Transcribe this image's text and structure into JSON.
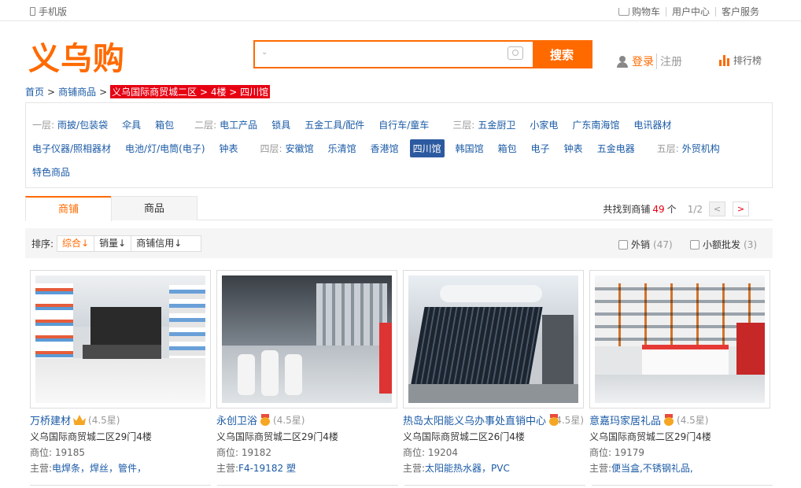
{
  "topbar": {
    "mobile": "手机版",
    "cart": "购物车",
    "user_center": "用户中心",
    "service": "客户服务"
  },
  "header": {
    "logo": "义乌购",
    "search": {
      "value": "",
      "placeholder": "",
      "button": "搜索"
    },
    "login": "登录",
    "register": "注册",
    "ranking": "排行榜"
  },
  "breadcrumb": {
    "home": "首页",
    "shops": "商铺商品",
    "current": "义乌国际商贸城二区 > 4楼 > 四川馆",
    "sep": ">"
  },
  "floors": {
    "row1": [
      {
        "label": "一层:",
        "items": [
          "雨披/包装袋",
          "伞具",
          "箱包"
        ]
      },
      {
        "label": "二层:",
        "items": [
          "电工产品",
          "锁具",
          "五金工具/配件",
          "自行车/童车"
        ]
      },
      {
        "label": "三层:",
        "items": [
          "五金厨卫",
          "小家电",
          "广东南海馆",
          "电讯器材"
        ]
      }
    ],
    "row2_plain": [
      "电子仪器/照相器材",
      "电池/灯/电筒(电子)",
      "钟表"
    ],
    "row2_floor4": {
      "label": "四层:",
      "items": [
        "安徽馆",
        "乐清馆",
        "香港馆",
        "四川馆",
        "韩国馆",
        "箱包",
        "电子",
        "钟表",
        "五金电器"
      ],
      "active": "四川馆"
    },
    "row2_floor5": {
      "label": "五层:",
      "items": [
        "外贸机构"
      ]
    },
    "row3": [
      "特色商品"
    ]
  },
  "tabs": {
    "shops": "商铺",
    "products": "商品",
    "found_prefix": "共找到商铺",
    "found_count": "49",
    "found_suffix": "个",
    "page": "1/2",
    "prev": "<",
    "next": ">"
  },
  "sort": {
    "label": "排序:",
    "options": [
      "综合",
      "销量",
      "商铺信用"
    ],
    "active": "综合",
    "filters": [
      {
        "label": "外销",
        "count": "(47)"
      },
      {
        "label": "小额批发",
        "count": "(3)"
      }
    ]
  },
  "shops": [
    {
      "name": "万桥建材",
      "badge": "crown",
      "rating": "(4.5星)",
      "address": "义乌国际商贸城二区29门4楼",
      "position": "商位: 19185",
      "biz_label": "主营:",
      "biz": "电焊条，焊丝，管件，"
    },
    {
      "name": "永创卫浴",
      "badge": "medal",
      "rating": "(4.5星)",
      "address": "义乌国际商贸城二区29门4楼",
      "position": "商位: 19182",
      "biz_label": "主营:",
      "biz": "F4-19182 塑"
    },
    {
      "name": "热岛太阳能义乌办事处直销中心",
      "badge": "medal",
      "rating": "(4.5星)",
      "address": "义乌国际商贸城二区26门4楼",
      "position": "商位: 19204",
      "biz_label": "主营:",
      "biz": "太阳能热水器，PVC"
    },
    {
      "name": "意嘉玛家居礼品",
      "badge": "medal",
      "rating": "(4.5星)",
      "address": "义乌国际商贸城二区29门4楼",
      "position": "商位: 19179",
      "biz_label": "主营:",
      "biz": "便当盒,不锈钢礼品,"
    }
  ],
  "colors": {
    "accent": "#ff6a00",
    "link": "#1a5aa6",
    "highlight": "#e60012",
    "active_floor": "#2c5aa0"
  }
}
